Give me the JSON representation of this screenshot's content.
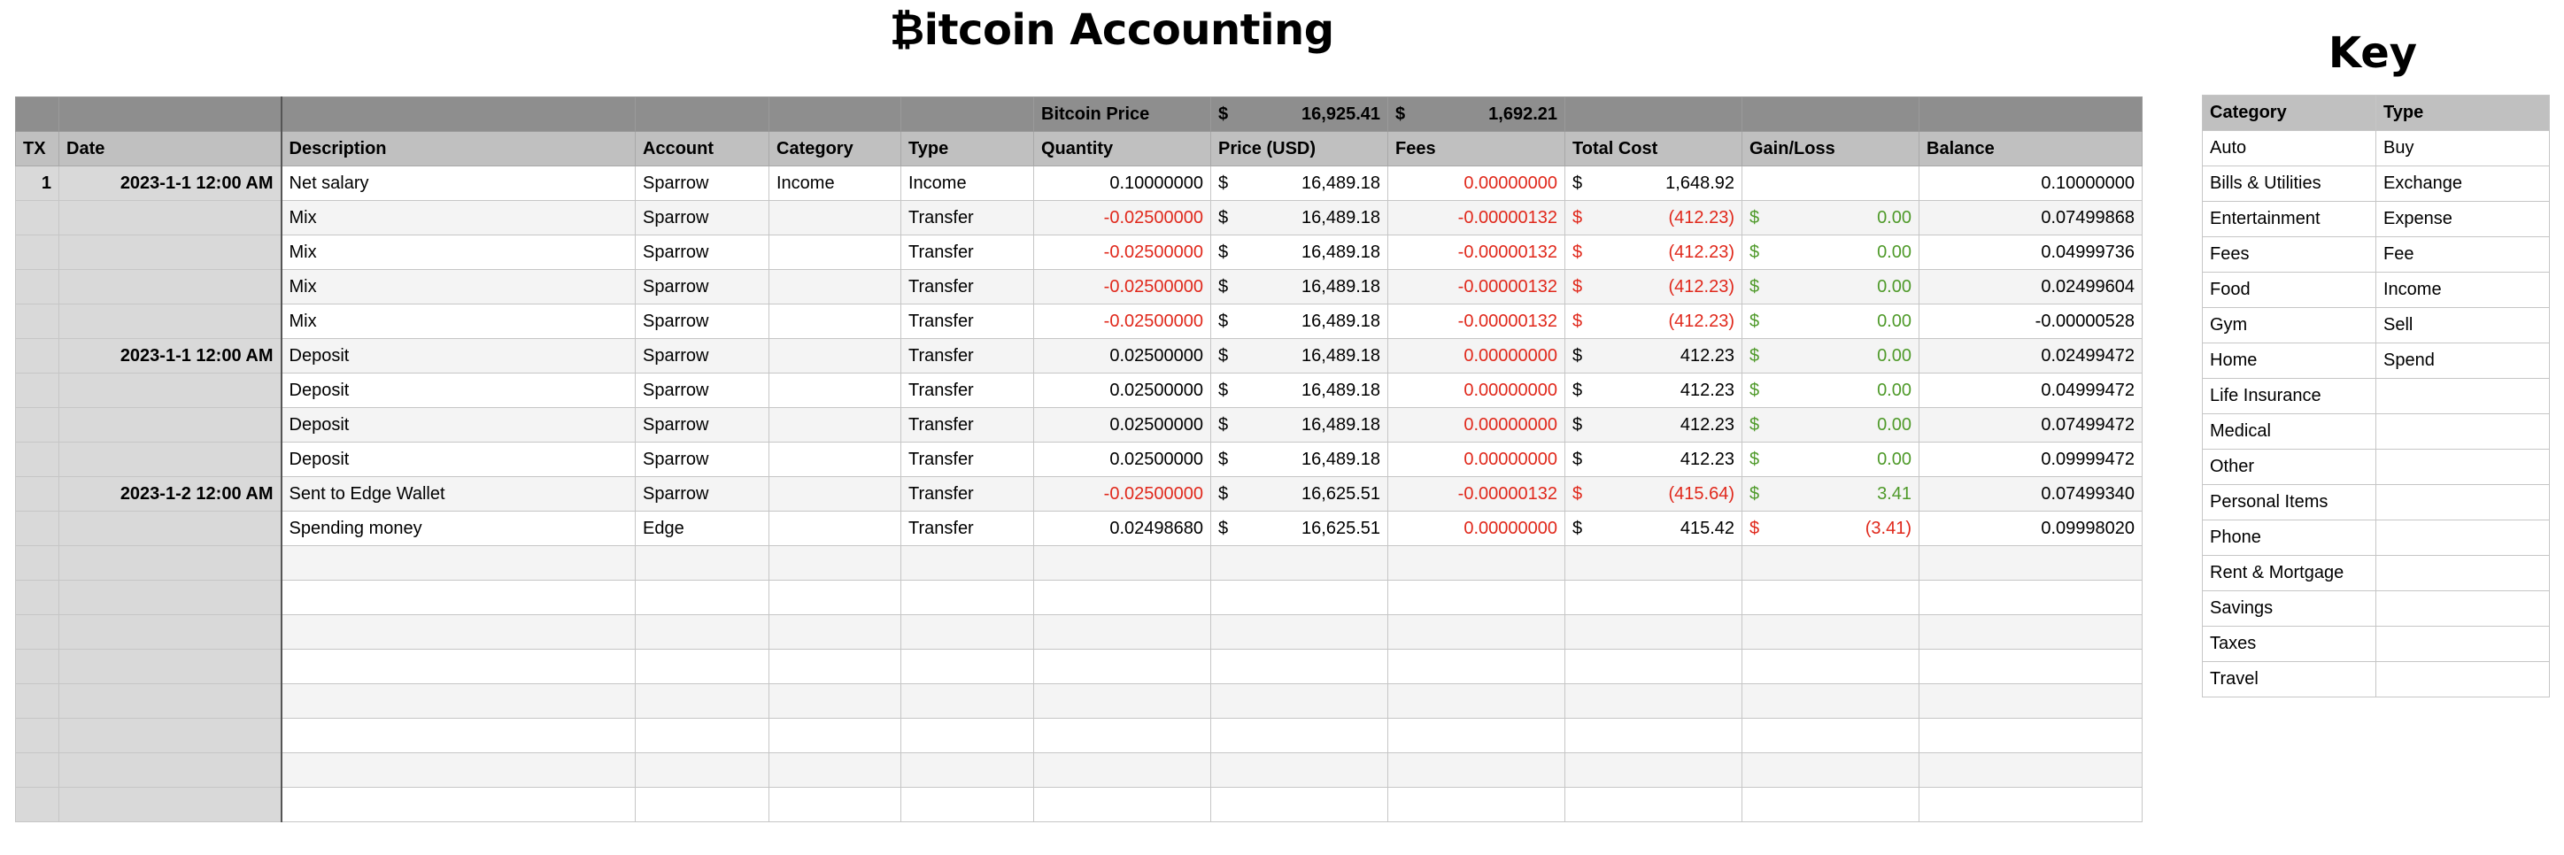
{
  "title": "₿itcoin Accounting",
  "key_title": "Key",
  "bitcoin_price": {
    "label": "Bitcoin Price",
    "sym1": "$",
    "price": "16,925.41",
    "sym2": "$",
    "value": "1,692.21"
  },
  "headers": [
    "TX",
    "Date",
    "Description",
    "Account",
    "Category",
    "Type",
    "Quantity",
    "Price (USD)",
    "Fees",
    "Total Cost",
    "Gain/Loss",
    "Balance"
  ],
  "rows": [
    {
      "tx": "1",
      "date": "2023-1-1 12:00 AM",
      "desc": "Net salary",
      "account": "Sparrow",
      "category": "Income",
      "type": "Income",
      "qty": "0.10000000",
      "qty_neg": false,
      "price": "16,489.18",
      "fees": "0.00000000",
      "cost": "1,648.92",
      "cost_neg": false,
      "gain": "",
      "gain_neg": false,
      "balance": "0.10000000"
    },
    {
      "tx": "",
      "date": "",
      "desc": "Mix",
      "account": "Sparrow",
      "category": "",
      "type": "Transfer",
      "qty": "-0.02500000",
      "qty_neg": true,
      "price": "16,489.18",
      "fees": "-0.00000132",
      "cost": "(412.23)",
      "cost_neg": true,
      "gain": "0.00",
      "gain_neg": false,
      "balance": "0.07499868"
    },
    {
      "tx": "",
      "date": "",
      "desc": "Mix",
      "account": "Sparrow",
      "category": "",
      "type": "Transfer",
      "qty": "-0.02500000",
      "qty_neg": true,
      "price": "16,489.18",
      "fees": "-0.00000132",
      "cost": "(412.23)",
      "cost_neg": true,
      "gain": "0.00",
      "gain_neg": false,
      "balance": "0.04999736"
    },
    {
      "tx": "",
      "date": "",
      "desc": "Mix",
      "account": "Sparrow",
      "category": "",
      "type": "Transfer",
      "qty": "-0.02500000",
      "qty_neg": true,
      "price": "16,489.18",
      "fees": "-0.00000132",
      "cost": "(412.23)",
      "cost_neg": true,
      "gain": "0.00",
      "gain_neg": false,
      "balance": "0.02499604"
    },
    {
      "tx": "",
      "date": "",
      "desc": "Mix",
      "account": "Sparrow",
      "category": "",
      "type": "Transfer",
      "qty": "-0.02500000",
      "qty_neg": true,
      "price": "16,489.18",
      "fees": "-0.00000132",
      "cost": "(412.23)",
      "cost_neg": true,
      "gain": "0.00",
      "gain_neg": false,
      "balance": "-0.00000528"
    },
    {
      "tx": "",
      "date": "2023-1-1 12:00 AM",
      "desc": "Deposit",
      "account": "Sparrow",
      "category": "",
      "type": "Transfer",
      "qty": "0.02500000",
      "qty_neg": false,
      "price": "16,489.18",
      "fees": "0.00000000",
      "cost": "412.23",
      "cost_neg": false,
      "gain": "0.00",
      "gain_neg": false,
      "balance": "0.02499472"
    },
    {
      "tx": "",
      "date": "",
      "desc": "Deposit",
      "account": "Sparrow",
      "category": "",
      "type": "Transfer",
      "qty": "0.02500000",
      "qty_neg": false,
      "price": "16,489.18",
      "fees": "0.00000000",
      "cost": "412.23",
      "cost_neg": false,
      "gain": "0.00",
      "gain_neg": false,
      "balance": "0.04999472"
    },
    {
      "tx": "",
      "date": "",
      "desc": "Deposit",
      "account": "Sparrow",
      "category": "",
      "type": "Transfer",
      "qty": "0.02500000",
      "qty_neg": false,
      "price": "16,489.18",
      "fees": "0.00000000",
      "cost": "412.23",
      "cost_neg": false,
      "gain": "0.00",
      "gain_neg": false,
      "balance": "0.07499472"
    },
    {
      "tx": "",
      "date": "",
      "desc": "Deposit",
      "account": "Sparrow",
      "category": "",
      "type": "Transfer",
      "qty": "0.02500000",
      "qty_neg": false,
      "price": "16,489.18",
      "fees": "0.00000000",
      "cost": "412.23",
      "cost_neg": false,
      "gain": "0.00",
      "gain_neg": false,
      "balance": "0.09999472"
    },
    {
      "tx": "",
      "date": "2023-1-2 12:00 AM",
      "desc": "Sent to Edge Wallet",
      "account": "Sparrow",
      "category": "",
      "type": "Transfer",
      "qty": "-0.02500000",
      "qty_neg": true,
      "price": "16,625.51",
      "fees": "-0.00000132",
      "cost": "(415.64)",
      "cost_neg": true,
      "gain": "3.41",
      "gain_neg": false,
      "balance": "0.07499340"
    },
    {
      "tx": "",
      "date": "",
      "desc": "Spending money",
      "account": "Edge",
      "category": "",
      "type": "Transfer",
      "qty": "0.02498680",
      "qty_neg": false,
      "price": "16,625.51",
      "fees": "0.00000000",
      "cost": "415.42",
      "cost_neg": false,
      "gain": "(3.41)",
      "gain_neg": true,
      "balance": "0.09998020"
    }
  ],
  "empty_rows": 8,
  "currency_symbol": "$",
  "key_headers": [
    "Category",
    "Type"
  ],
  "key_rows": [
    [
      "Auto",
      "Buy"
    ],
    [
      "Bills & Utilities",
      "Exchange"
    ],
    [
      "Entertainment",
      "Expense"
    ],
    [
      "Fees",
      "Fee"
    ],
    [
      "Food",
      "Income"
    ],
    [
      "Gym",
      "Sell"
    ],
    [
      "Home",
      "Spend"
    ],
    [
      "Life Insurance",
      ""
    ],
    [
      "Medical",
      ""
    ],
    [
      "Other",
      ""
    ],
    [
      "Personal Items",
      ""
    ],
    [
      "Phone",
      ""
    ],
    [
      "Rent & Mortgage",
      ""
    ],
    [
      "Savings",
      ""
    ],
    [
      "Taxes",
      ""
    ],
    [
      "Travel",
      ""
    ]
  ],
  "colors": {
    "negative": "#e0281b",
    "positive": "#4f9a2a",
    "header_dark": "#8e8e8e",
    "header_light": "#c0c0c0"
  }
}
